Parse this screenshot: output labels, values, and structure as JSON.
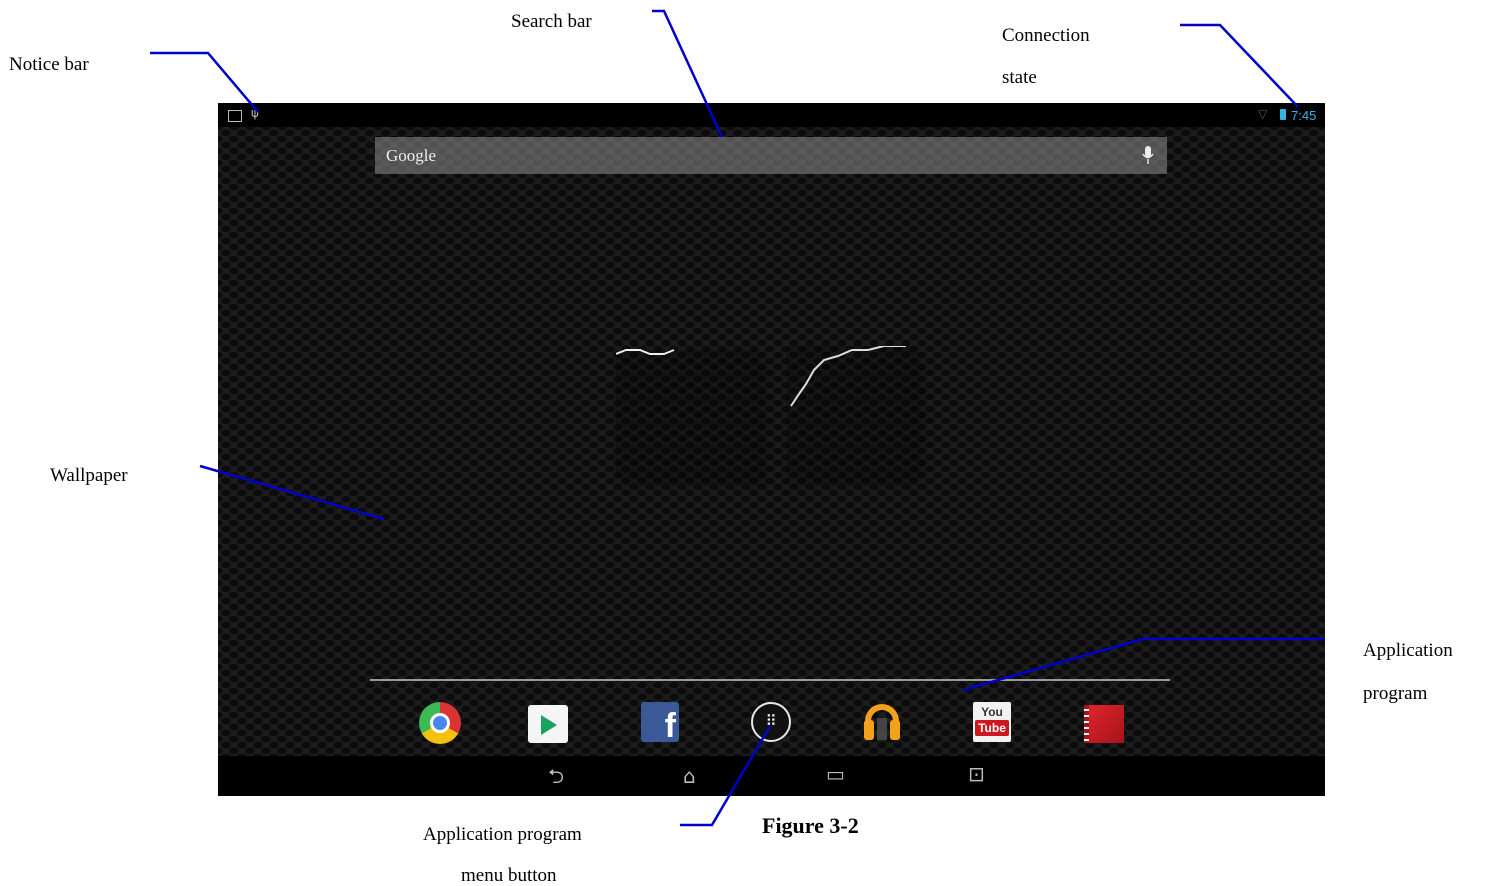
{
  "annotations": {
    "notice_bar": "Notice bar",
    "search_bar": "Search bar",
    "connection_state_line1": "Connection",
    "connection_state_line2": "state",
    "wallpaper": "Wallpaper",
    "application_program_line1": "Application",
    "application_program_line2": "program",
    "menu_button_line1": "Application program",
    "menu_button_line2": "menu button",
    "figure_caption": "Figure 3-2"
  },
  "statusbar": {
    "time": "7:45",
    "left_icons": [
      "image-icon",
      "usb-icon"
    ],
    "right_icons": [
      "wifi-icon",
      "battery-icon"
    ],
    "accent_color": "#33b5e5"
  },
  "searchbar": {
    "label": "Google",
    "icon": "microphone-icon"
  },
  "dock": {
    "apps": [
      "chrome-icon",
      "play-store-icon",
      "facebook-icon",
      "app-menu-icon",
      "play-music-icon",
      "youtube-icon",
      "play-movies-icon"
    ],
    "facebook_glyph": "f",
    "youtube_you": "You",
    "youtube_tube": "Tube",
    "menu_glyph": "⠿"
  },
  "navbar": {
    "buttons": [
      "back-icon",
      "home-icon",
      "recents-icon",
      "screenshot-icon"
    ],
    "back_glyph": "⮌",
    "home_glyph": "⌂",
    "recents_glyph": "▭",
    "screenshot_glyph": "⊡"
  },
  "colors": {
    "callout_line": "#0000cc",
    "wallpaper": "#1d1d1d"
  }
}
